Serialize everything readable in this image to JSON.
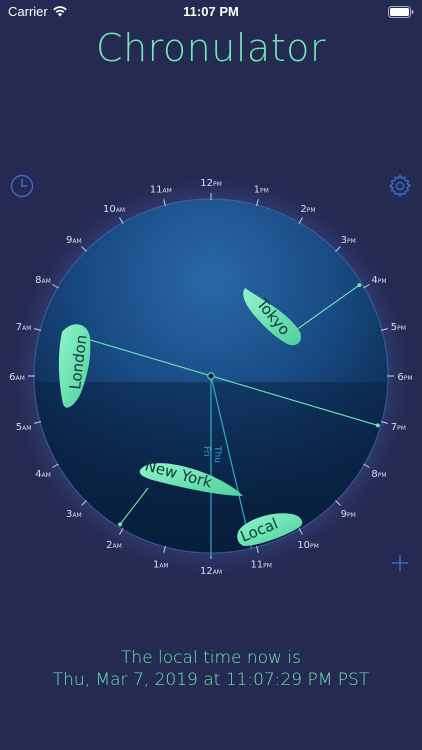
{
  "status_bar": {
    "carrier": "Carrier",
    "time": "11:07 PM"
  },
  "app": {
    "title": "Chronulator"
  },
  "icons": {
    "clock": "clock-icon",
    "settings": "gear-icon",
    "add": "plus-icon",
    "wifi": "wifi-icon",
    "battery": "battery-icon"
  },
  "colors": {
    "background": "#242a52",
    "accent": "#6fe6b3",
    "icon_blue": "#3a6cc9",
    "line_blue": "#2ea3c2"
  },
  "dial": {
    "hour_marks": [
      {
        "num": "12",
        "ampm": "PM"
      },
      {
        "num": "1",
        "ampm": "PM"
      },
      {
        "num": "2",
        "ampm": "PM"
      },
      {
        "num": "3",
        "ampm": "PM"
      },
      {
        "num": "4",
        "ampm": "PM"
      },
      {
        "num": "5",
        "ampm": "PM"
      },
      {
        "num": "6",
        "ampm": "PM"
      },
      {
        "num": "7",
        "ampm": "PM"
      },
      {
        "num": "8",
        "ampm": "PM"
      },
      {
        "num": "9",
        "ampm": "PM"
      },
      {
        "num": "10",
        "ampm": "PM"
      },
      {
        "num": "11",
        "ampm": "PM"
      },
      {
        "num": "12",
        "ampm": "AM"
      },
      {
        "num": "1",
        "ampm": "AM"
      },
      {
        "num": "2",
        "ampm": "AM"
      },
      {
        "num": "3",
        "ampm": "AM"
      },
      {
        "num": "4",
        "ampm": "AM"
      },
      {
        "num": "5",
        "ampm": "AM"
      },
      {
        "num": "6",
        "ampm": "AM"
      },
      {
        "num": "7",
        "ampm": "AM"
      },
      {
        "num": "8",
        "ampm": "AM"
      },
      {
        "num": "9",
        "ampm": "AM"
      },
      {
        "num": "10",
        "ampm": "AM"
      },
      {
        "num": "11",
        "ampm": "AM"
      }
    ],
    "day_divider": {
      "before": "Fri",
      "after": "Thu"
    },
    "cities": [
      {
        "label": "Tokyo",
        "hour": 15.9
      },
      {
        "label": "London",
        "hour": 19.1
      },
      {
        "label": "New York",
        "hour": 2.1
      },
      {
        "label": "Local",
        "hour": 23.12
      }
    ]
  },
  "footer": {
    "caption": "The local time now is",
    "value": "Thu, Mar 7, 2019 at 11:07:29 PM PST"
  }
}
